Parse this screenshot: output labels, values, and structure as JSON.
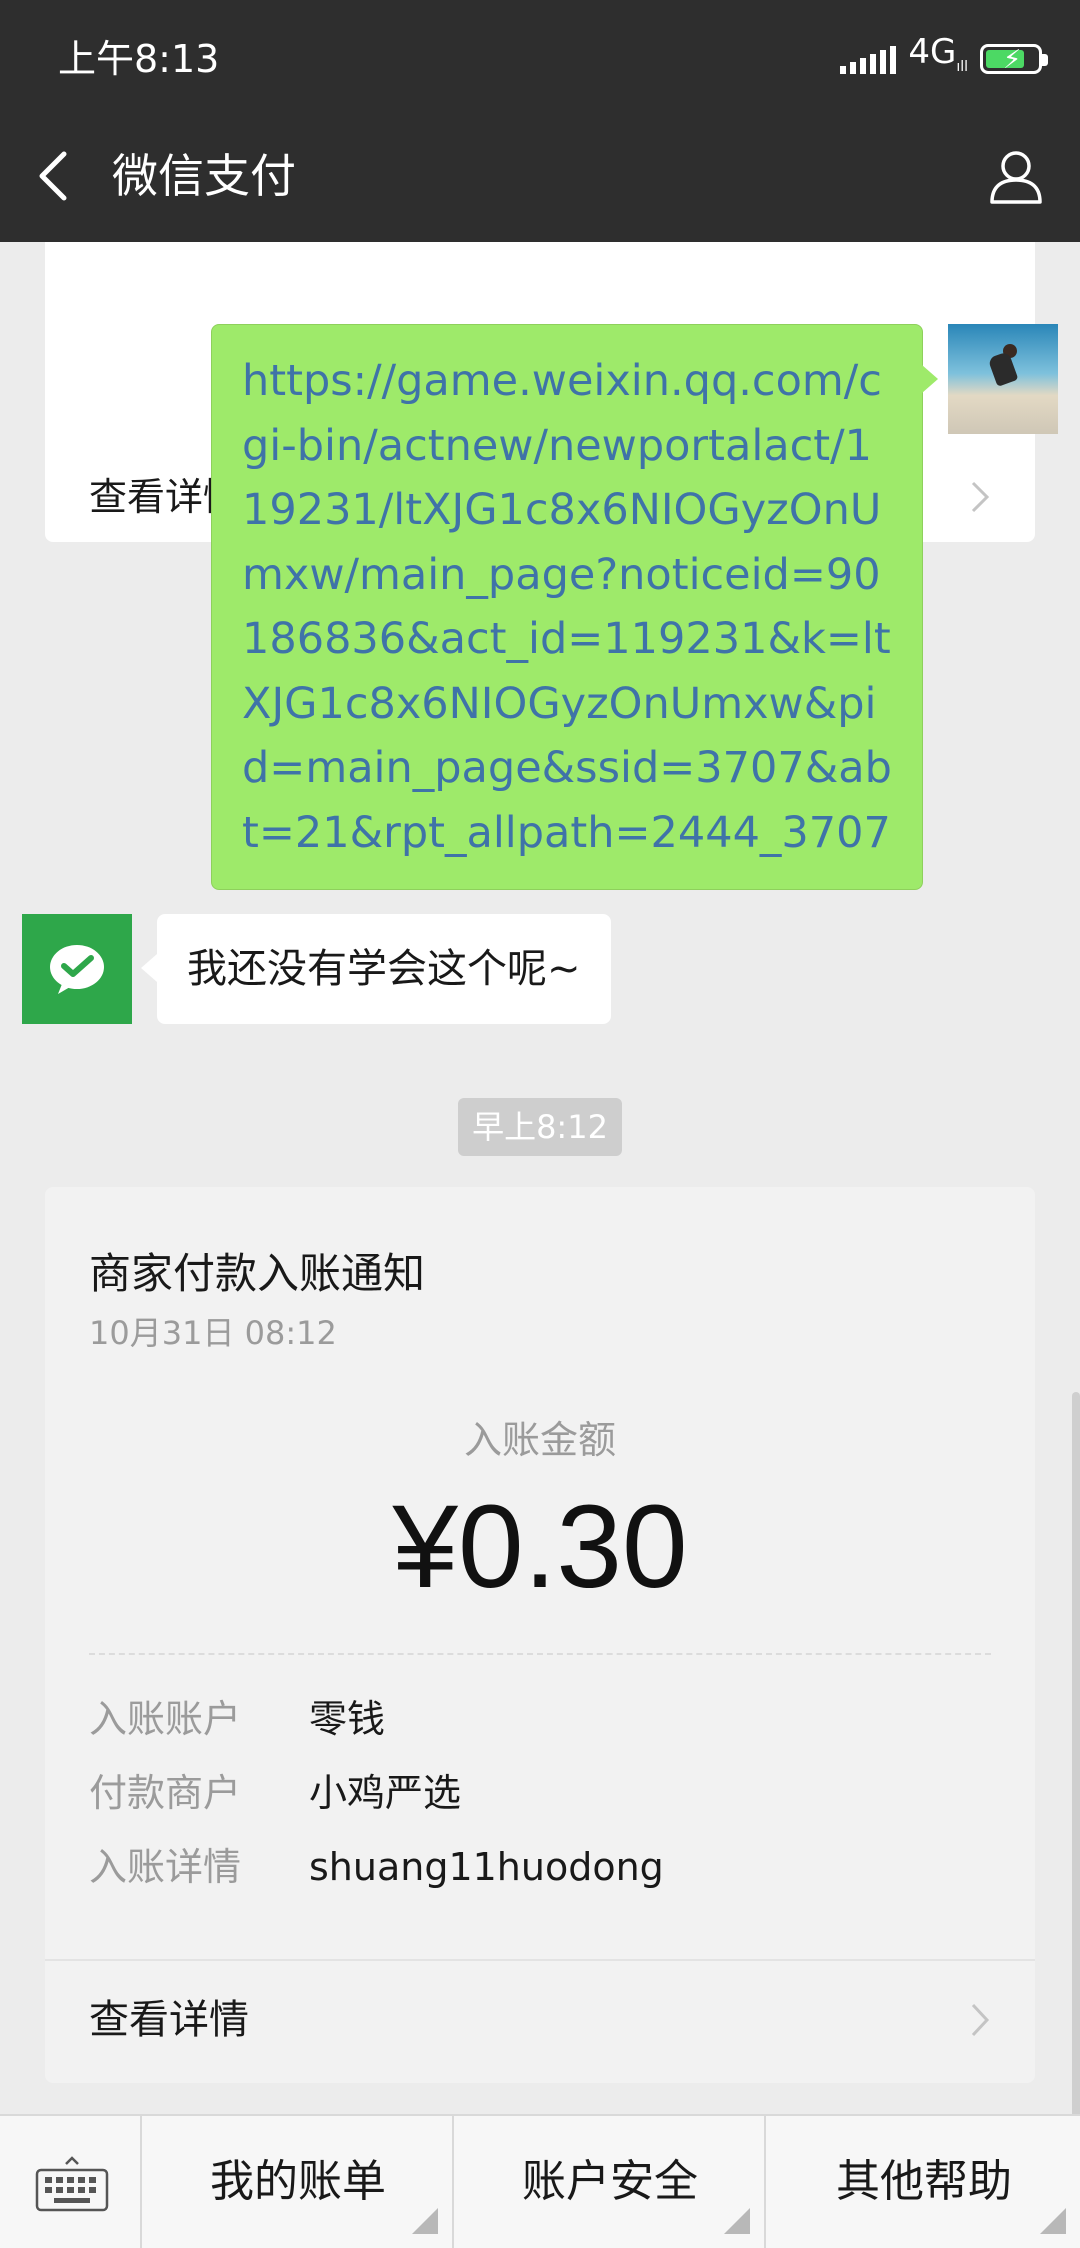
{
  "status_bar": {
    "time": "上午8:13",
    "network": "4G",
    "network_sub": "ıll"
  },
  "header": {
    "title": "微信支付"
  },
  "previous_card": {
    "detail_label": "查看详情"
  },
  "messages": {
    "link_text": "https://game.weixin.qq.com/cgi-bin/actnew/newportalact/119231/ltXJG1c8x6NIOGyzOnUmxw/main_page?noticeid=90186836&act_id=119231&k=ltXJG1c8x6NIOGyzOnUmxw&pid=main_page&ssid=3707&abt=21&rpt_allpath=2444_3707",
    "reply_text": "我还没有学会这个呢~",
    "timestamp": "早上8:12"
  },
  "payment_card": {
    "title": "商家付款入账通知",
    "date": "10月31日  08:12",
    "amount_label": "入账金额",
    "amount": "¥0.30",
    "rows": [
      {
        "label": "入账账户",
        "value": "零钱"
      },
      {
        "label": "付款商户",
        "value": "小鸡严选"
      },
      {
        "label": "入账详情",
        "value": "shuang11huodong"
      }
    ],
    "detail_label": "查看详情"
  },
  "menu": {
    "items": [
      {
        "label": "我的账单"
      },
      {
        "label": "账户安全"
      },
      {
        "label": "其他帮助"
      }
    ]
  },
  "colors": {
    "topbar": "#2e2e2e",
    "background": "#ececec",
    "sent_bubble": "#9eea6a",
    "link": "#3f73a8",
    "wechat_pay_green": "#2ea74a"
  },
  "icons": {
    "back": "back-arrow-icon",
    "profile": "person-icon",
    "keyboard": "keyboard-icon",
    "chevron": "chevron-right-icon",
    "pay_logo": "wechat-pay-logo-icon"
  }
}
